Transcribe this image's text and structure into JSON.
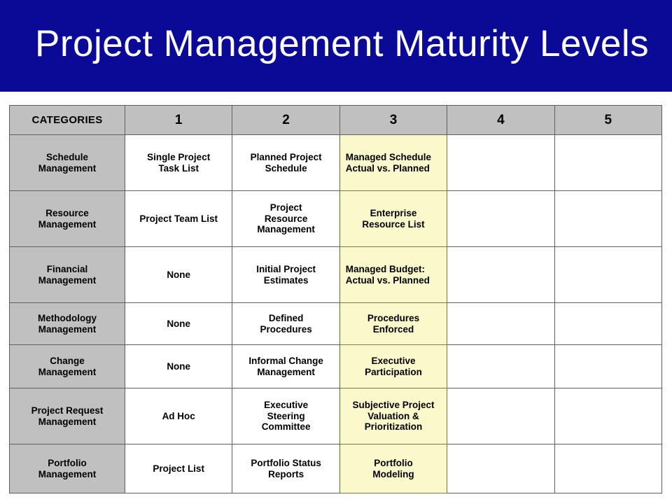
{
  "slide": {
    "title": "Project Management Maturity Levels",
    "banner_color": "#0A0A96",
    "title_color": "#FFFFFF",
    "background_color": "#FFFFFF"
  },
  "table": {
    "header_bg_color": "#C0C0C0",
    "category_bg_color": "#C0C0C0",
    "highlight_bg_color": "#FBF8CC",
    "border_color": "#5F5F5F",
    "columns": [
      "CATEGORIES",
      "1",
      "2",
      "3",
      "4",
      "5"
    ],
    "rows": [
      {
        "category": "Schedule Management",
        "category_lines": [
          "Schedule",
          "Management"
        ],
        "level1": "Single Project Task List",
        "level1_lines": [
          "Single Project",
          "Task List"
        ],
        "level2": "Planned Project Schedule",
        "level2_lines": [
          "Planned Project",
          "Schedule"
        ],
        "level3": "Managed Schedule Actual vs. Planned",
        "level3_lines": [
          "Managed Schedule",
          "Actual vs. Planned"
        ],
        "level3_align": "left",
        "level4": "",
        "level5": ""
      },
      {
        "category": "Resource Management",
        "category_lines": [
          "Resource",
          "Management"
        ],
        "level1": "Project Team List",
        "level1_lines": [
          "Project Team List"
        ],
        "level2": "Project Resource Management",
        "level2_lines": [
          "Project",
          "Resource",
          "Management"
        ],
        "level3": "Enterprise Resource List",
        "level3_lines": [
          "Enterprise",
          "Resource List"
        ],
        "level3_align": "center",
        "level4": "",
        "level5": ""
      },
      {
        "category": "Financial Management",
        "category_lines": [
          "Financial",
          "Management"
        ],
        "level1": "None",
        "level1_lines": [
          "None"
        ],
        "level2": "Initial Project Estimates",
        "level2_lines": [
          "Initial Project",
          "Estimates"
        ],
        "level3": "Managed Budget: Actual vs. Planned",
        "level3_lines": [
          "Managed Budget:",
          "Actual vs. Planned"
        ],
        "level3_align": "left",
        "level4": "",
        "level5": ""
      },
      {
        "category": "Methodology Management",
        "category_lines": [
          "Methodology",
          "Management"
        ],
        "level1": "None",
        "level1_lines": [
          "None"
        ],
        "level2": "Defined Procedures",
        "level2_lines": [
          "Defined",
          "Procedures"
        ],
        "level3": "Procedures Enforced",
        "level3_lines": [
          "Procedures",
          "Enforced"
        ],
        "level3_align": "center",
        "level4": "",
        "level5": ""
      },
      {
        "category": "Change Management",
        "category_lines": [
          "Change",
          "Management"
        ],
        "level1": "None",
        "level1_lines": [
          "None"
        ],
        "level2": "Informal Change Management",
        "level2_lines": [
          "Informal Change",
          "Management"
        ],
        "level3": "Executive Participation",
        "level3_lines": [
          "Executive",
          "Participation"
        ],
        "level3_align": "center",
        "level4": "",
        "level5": ""
      },
      {
        "category": "Project Request Management",
        "category_lines": [
          "Project Request",
          "Management"
        ],
        "level1": "Ad Hoc",
        "level1_lines": [
          "Ad Hoc"
        ],
        "level2": "Executive Steering Committee",
        "level2_lines": [
          "Executive",
          "Steering",
          "Committee"
        ],
        "level3": "Subjective Project Valuation & Prioritization",
        "level3_lines": [
          "Subjective Project",
          "Valuation &",
          "Prioritization"
        ],
        "level3_align": "center",
        "level4": "",
        "level5": ""
      },
      {
        "category": "Portfolio Management",
        "category_lines": [
          "Portfolio",
          "Management"
        ],
        "level1": "Project List",
        "level1_lines": [
          "Project List"
        ],
        "level2": "Portfolio Status Reports",
        "level2_lines": [
          "Portfolio Status",
          "Reports"
        ],
        "level3": "Portfolio Modeling",
        "level3_lines": [
          "Portfolio",
          "Modeling"
        ],
        "level3_align": "center",
        "level4": "",
        "level5": ""
      }
    ]
  }
}
